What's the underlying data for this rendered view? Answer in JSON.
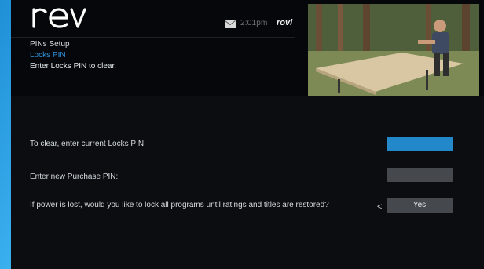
{
  "header": {
    "logo_text": "rev",
    "clock": "2:01pm",
    "brand": "rovi",
    "breadcrumb": {
      "level1": "PINs Setup",
      "level2": "Locks PIN",
      "instruction": "Enter Locks PIN to clear."
    }
  },
  "form": {
    "current_pin_label": "To clear, enter current Locks PIN:",
    "new_pin_label": "Enter new Purchase PIN:",
    "power_loss_label": "If power is lost, would you like to lock all programs until ratings and titles are restored?",
    "power_loss_value": "Yes",
    "arrow": "<"
  },
  "colors": {
    "accent_blue": "#2288c9",
    "field_gray": "#45484c",
    "background": "#0b0d10"
  },
  "icons": {
    "mail": "mail-icon",
    "video": "video-preview"
  }
}
